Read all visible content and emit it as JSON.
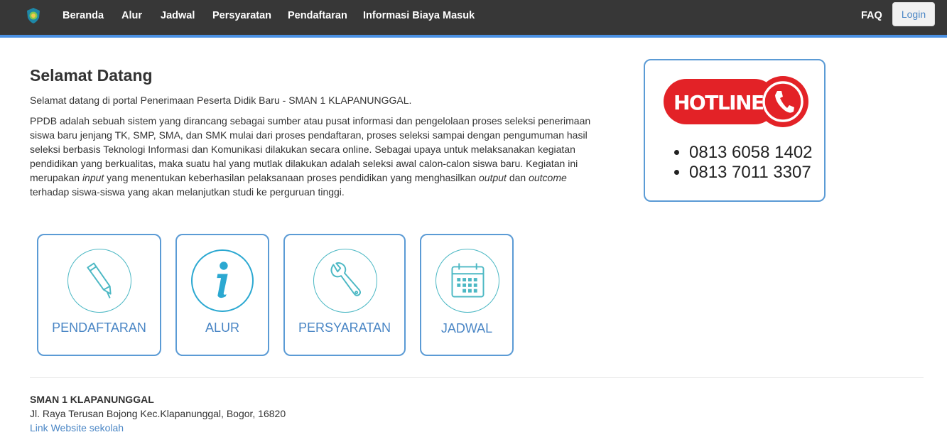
{
  "navbar": {
    "logo_icon": "school-emblem-icon",
    "items": [
      "Beranda",
      "Alur",
      "Jadwal",
      "Persyaratan",
      "Pendaftaran",
      "Informasi Biaya Masuk"
    ],
    "faq": "FAQ",
    "login": "Login",
    "background": "#373737",
    "accent": "#4a90e2"
  },
  "welcome": {
    "title": "Selamat Datang",
    "intro": "Selamat datang di portal Penerimaan Peserta Didik Baru - SMAN 1 KLAPANUNGGAL.",
    "desc_1": "PPDB adalah sebuah sistem yang dirancang sebagai sumber atau pusat informasi dan pengelolaan proses seleksi penerimaan siswa baru jenjang TK, SMP, SMA, dan SMK mulai dari proses pendaftaran, proses seleksi sampai dengan pengumuman hasil seleksi berbasis Teknologi Informasi dan Komunikasi dilakukan secara online. Sebagai upaya untuk melaksanakan kegiatan pendidikan yang berkualitas, maka suatu hal yang mutlak dilakukan adalah seleksi awal calon-calon siswa baru.  Kegiatan ini merupakan ",
    "desc_input": "input",
    "desc_2": " yang menentukan keberhasilan pelaksanaan proses pendidikan yang menghasilkan ",
    "desc_output": "output",
    "desc_3": " dan ",
    "desc_outcome": "outcome",
    "desc_4": " terhadap siswa-siswa yang akan melanjutkan studi ke perguruan tinggi."
  },
  "hotline": {
    "badge_text": "HOTLINE",
    "badge_color": "#e32227",
    "icon": "phone-icon",
    "numbers": [
      "0813 6058 1402",
      "0813 7011 3307"
    ]
  },
  "cards": [
    {
      "label": "PENDAFTARAN",
      "icon": "pen-icon"
    },
    {
      "label": "ALUR",
      "icon": "info-icon"
    },
    {
      "label": "PERSYARATAN",
      "icon": "wrench-icon"
    },
    {
      "label": "JADWAL",
      "icon": "calendar-icon"
    }
  ],
  "footer": {
    "school_name": "SMAN 1 KLAPANUNGGAL",
    "address": "Jl. Raya Terusan Bojong Kec.Klapanunggal, Bogor, 16820",
    "link": "Link Website sekolah"
  }
}
